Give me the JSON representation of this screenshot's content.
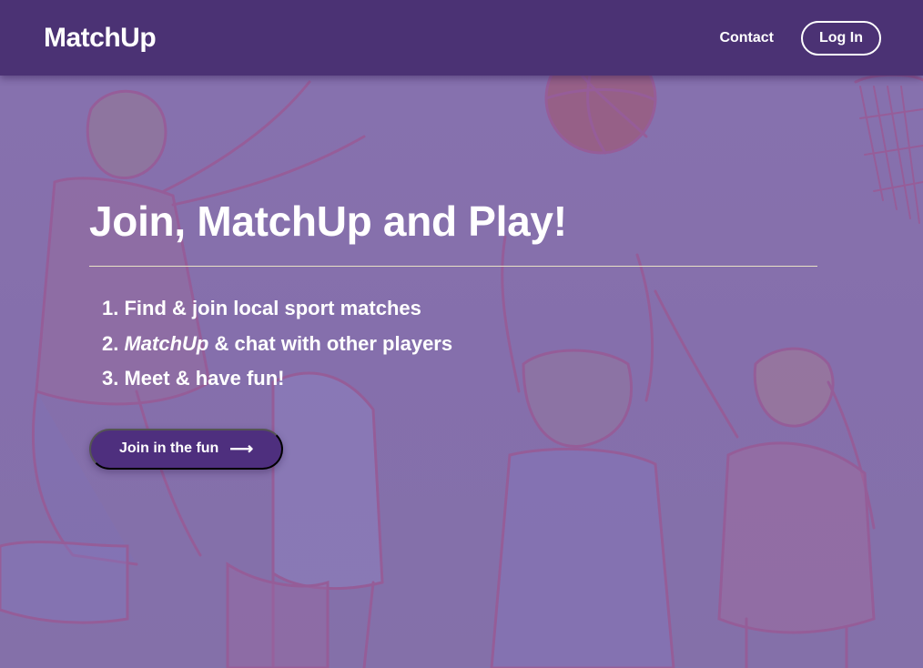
{
  "brand": {
    "name": "MatchUp"
  },
  "nav": {
    "contact_label": "Contact",
    "login_label": "Log In"
  },
  "hero": {
    "headline": "Join, MatchUp and Play!",
    "steps": [
      {
        "number": "1.",
        "text": "Find & join local sport matches"
      },
      {
        "number": "2.",
        "emphasis": "MatchUp",
        "text": " & chat with other players"
      },
      {
        "number": "3.",
        "text": "Meet & have fun!"
      }
    ],
    "cta_label": "Join in the fun",
    "cta_icon": "arrow-right-icon",
    "background_image": "basketball-players-illustration"
  },
  "colors": {
    "navbar": "#4b3274",
    "hero_tint": "#8a78aa",
    "cta": "#4e2f7e",
    "rule": "#e9e2c6",
    "text": "#ffffff"
  }
}
